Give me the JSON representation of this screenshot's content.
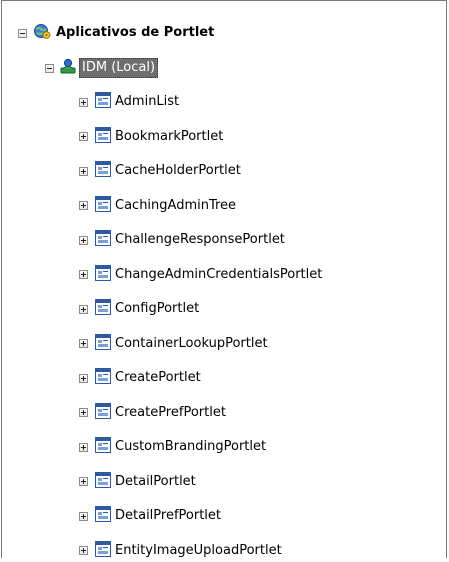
{
  "tree": {
    "root": {
      "label": "Aplicativos de Portlet",
      "icon": "globe-gear-icon"
    },
    "server": {
      "label": "IDM (Local)",
      "icon": "server-user-icon"
    },
    "portlets": [
      {
        "label": "AdminList"
      },
      {
        "label": "BookmarkPortlet"
      },
      {
        "label": "CacheHolderPortlet"
      },
      {
        "label": "CachingAdminTree"
      },
      {
        "label": "ChallengeResponsePortlet"
      },
      {
        "label": "ChangeAdminCredentialsPortlet"
      },
      {
        "label": "ConfigPortlet"
      },
      {
        "label": "ContainerLookupPortlet"
      },
      {
        "label": "CreatePortlet"
      },
      {
        "label": "CreatePrefPortlet"
      },
      {
        "label": "CustomBrandingPortlet"
      },
      {
        "label": "DetailPortlet"
      },
      {
        "label": "DetailPrefPortlet"
      },
      {
        "label": "EntityImageUploadPortlet"
      }
    ]
  },
  "colors": {
    "selection_bg": "#6e6e6e",
    "portlet_icon_blue": "#2d5aa0"
  }
}
